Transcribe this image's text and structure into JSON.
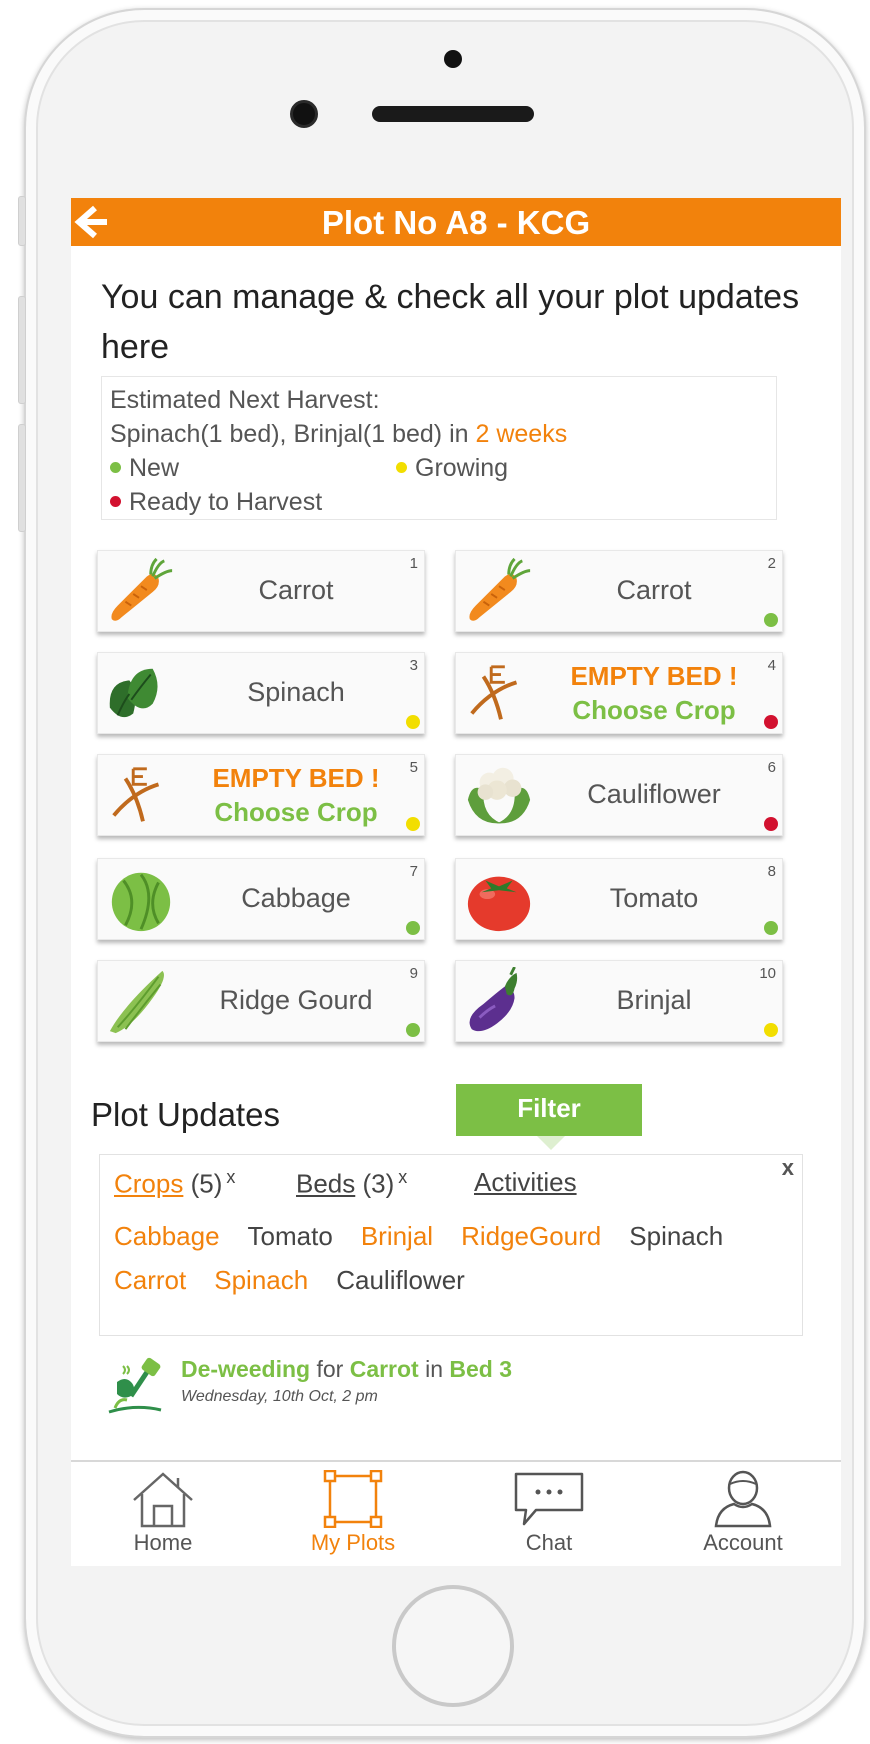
{
  "app": {
    "title": "Plot No A8 - KCG",
    "intro": "You can manage & check all your plot updates here"
  },
  "colors": {
    "accent": "#f2820c",
    "green": "#7cbf45",
    "new": "#7cbf45",
    "growing": "#f2de00",
    "ready": "#d2112f"
  },
  "harvest": {
    "label": "Estimated Next Harvest:",
    "crops_text": "Spinach(1 bed), Brinjal(1 bed) in ",
    "weeks": "2 weeks"
  },
  "legend": [
    {
      "label": "New",
      "status": "new"
    },
    {
      "label": "Growing",
      "status": "growing"
    },
    {
      "label": "Ready to Harvest",
      "status": "ready"
    }
  ],
  "beds": [
    {
      "num": "1",
      "name": "Carrot",
      "icon": "carrot-icon",
      "status": ""
    },
    {
      "num": "2",
      "name": "Carrot",
      "icon": "carrot-icon",
      "status": "new"
    },
    {
      "num": "3",
      "name": "Spinach",
      "icon": "spinach-icon",
      "status": "growing"
    },
    {
      "num": "4",
      "name": "",
      "empty": true,
      "empty_line1": "EMPTY BED !",
      "empty_line2": "Choose Crop",
      "icon": "sprout-icon",
      "status": "ready"
    },
    {
      "num": "5",
      "name": "",
      "empty": true,
      "empty_line1": "EMPTY BED !",
      "empty_line2": "Choose Crop",
      "icon": "sprout-icon",
      "status": "growing"
    },
    {
      "num": "6",
      "name": "Cauliflower",
      "icon": "cauliflower-icon",
      "status": "ready"
    },
    {
      "num": "7",
      "name": "Cabbage",
      "icon": "cabbage-icon",
      "status": "new"
    },
    {
      "num": "8",
      "name": "Tomato",
      "icon": "tomato-icon",
      "status": "new"
    },
    {
      "num": "9",
      "name": "Ridge Gourd",
      "icon": "ridge-gourd-icon",
      "status": "new"
    },
    {
      "num": "10",
      "name": "Brinjal",
      "icon": "brinjal-icon",
      "status": "growing"
    }
  ],
  "updates": {
    "title": "Plot Updates",
    "filter_label": "Filter",
    "close": "x",
    "tabs": [
      {
        "name": "Crops",
        "count": "(5)",
        "close": "x"
      },
      {
        "name": "Beds",
        "count": "(3)",
        "close": "x"
      },
      {
        "name": "Activities",
        "count": "",
        "close": ""
      }
    ],
    "crop_rows": [
      [
        {
          "name": "Cabbage",
          "on": true
        },
        {
          "name": "Tomato",
          "on": false
        },
        {
          "name": "Brinjal",
          "on": true
        },
        {
          "name": "RidgeGourd",
          "on": true
        },
        {
          "name": "Spinach",
          "on": false
        }
      ],
      [
        {
          "name": "Carrot",
          "on": true
        },
        {
          "name": "Spinach",
          "on": true
        },
        {
          "name": "Cauliflower",
          "on": false
        }
      ]
    ]
  },
  "activity": {
    "action": "De-weeding",
    "for": " for ",
    "crop": "Carrot",
    "in": " in ",
    "bed": "Bed 3",
    "time": "Wednesday, 10th Oct, 2 pm"
  },
  "tabbar": [
    {
      "label": "Home",
      "icon": "home-icon",
      "active": false
    },
    {
      "label": "My Plots",
      "icon": "plots-icon",
      "active": true
    },
    {
      "label": "Chat",
      "icon": "chat-icon",
      "active": false
    },
    {
      "label": "Account",
      "icon": "account-icon",
      "active": false
    }
  ]
}
